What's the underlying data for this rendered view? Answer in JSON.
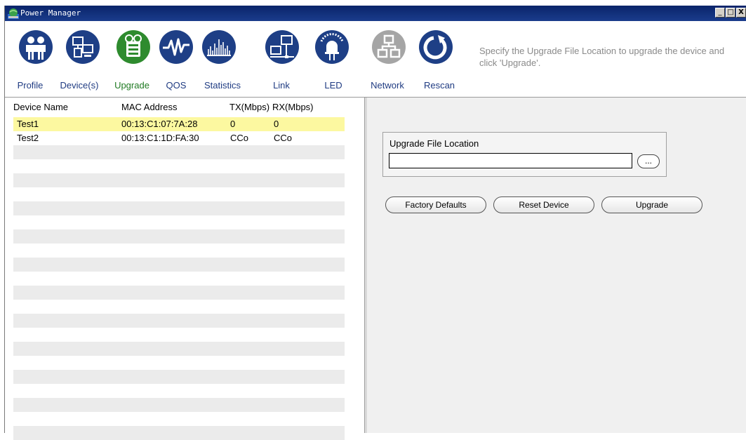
{
  "window": {
    "title": "Power Manager",
    "minimize_label": "_",
    "maximize_label": "□",
    "close_label": "X"
  },
  "toolbar": {
    "items": [
      {
        "label": "Profile",
        "icon": "people-icon",
        "color": "#1e3f86"
      },
      {
        "label": "Device(s)",
        "icon": "computers-icon",
        "color": "#1e3f86"
      },
      {
        "label": "Upgrade",
        "icon": "upgrade-package-icon",
        "color": "#2e8b2e"
      },
      {
        "label": "QOS",
        "icon": "waveform-icon",
        "color": "#1e3f86"
      },
      {
        "label": "Statistics",
        "icon": "bar-graph-icon",
        "color": "#1e3f86"
      },
      {
        "label": "Link",
        "icon": "network-link-icon",
        "color": "#1e3f86"
      },
      {
        "label": "LED",
        "icon": "led-bulb-icon",
        "color": "#1e3f86"
      },
      {
        "label": "Network",
        "icon": "network-tree-icon",
        "color": "#a5a5a5"
      },
      {
        "label": "Rescan",
        "icon": "refresh-icon",
        "color": "#1e3f86"
      }
    ],
    "active": "Upgrade"
  },
  "hint": "Specify the Upgrade File Location to upgrade the device and click 'Upgrade'.",
  "device_table": {
    "columns": [
      "Device Name",
      "MAC Address",
      "TX(Mbps)",
      "RX(Mbps)"
    ],
    "rows": [
      {
        "name": "Test1",
        "mac": "00:13:C1:07:7A:28",
        "tx": "0",
        "rx": "0",
        "selected": true
      },
      {
        "name": "Test2",
        "mac": "00:13:C1:1D:FA:30",
        "tx": "CCo",
        "rx": "CCo",
        "selected": false
      }
    ],
    "selected_row_color": "#fcf8a0"
  },
  "upgrade_panel": {
    "group_label": "Upgrade File Location",
    "file_value": "",
    "browse_label": "...",
    "buttons": {
      "factory_defaults": "Factory Defaults",
      "reset_device": "Reset Device",
      "upgrade": "Upgrade"
    }
  }
}
